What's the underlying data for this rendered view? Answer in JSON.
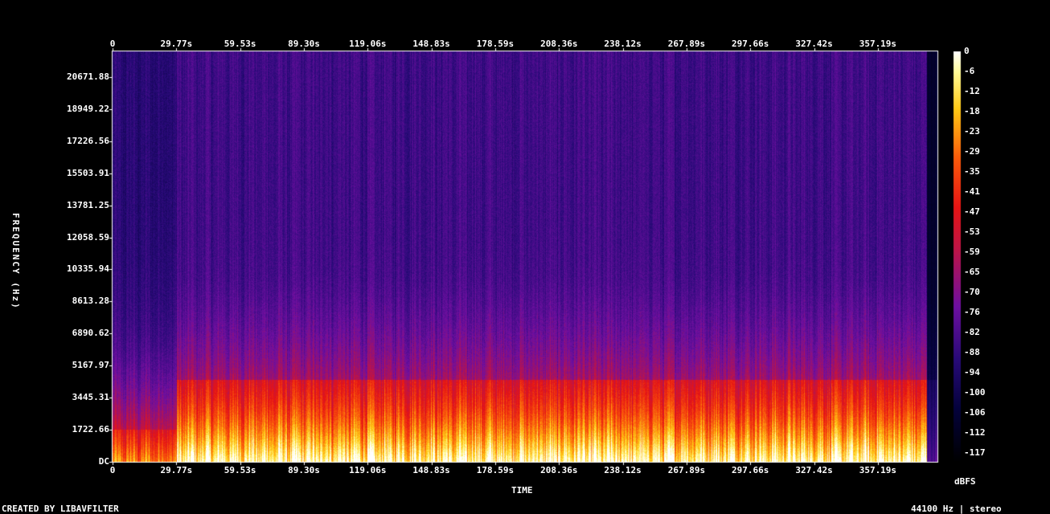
{
  "chart_data": {
    "type": "heatmap",
    "title": "",
    "xlabel": "TIME",
    "ylabel": "FREQUENCY (Hz)",
    "x_ticks": [
      "0",
      "29.77s",
      "59.53s",
      "89.30s",
      "119.06s",
      "148.83s",
      "178.59s",
      "208.36s",
      "238.12s",
      "267.89s",
      "297.66s",
      "327.42s",
      "357.19s"
    ],
    "x_tick_values": [
      0,
      29.77,
      59.53,
      89.3,
      119.06,
      148.83,
      178.59,
      208.36,
      238.12,
      267.89,
      297.66,
      327.42,
      357.19
    ],
    "xlim": [
      0,
      385
    ],
    "y_ticks": [
      "DC",
      "1722.66",
      "3445.31",
      "5167.97",
      "6890.62",
      "8613.28",
      "10335.94",
      "12058.59",
      "13781.25",
      "15503.91",
      "17226.56",
      "18949.22",
      "20671.88"
    ],
    "y_tick_values": [
      0,
      1722.66,
      3445.31,
      5167.97,
      6890.62,
      8613.28,
      10335.94,
      12058.59,
      13781.25,
      15503.91,
      17226.56,
      18949.22,
      20671.88
    ],
    "ylim": [
      0,
      22050
    ],
    "colorbar": {
      "label": "dBFS",
      "ticks": [
        "0",
        "-6",
        "-12",
        "-18",
        "-23",
        "-29",
        "-35",
        "-41",
        "-47",
        "-53",
        "-59",
        "-65",
        "-70",
        "-76",
        "-82",
        "-88",
        "-94",
        "-100",
        "-106",
        "-112",
        "-117"
      ],
      "range": [
        -120,
        0
      ]
    },
    "footer_left": "CREATED BY LIBAVFILTER",
    "footer_right": "44100 Hz | stereo"
  }
}
